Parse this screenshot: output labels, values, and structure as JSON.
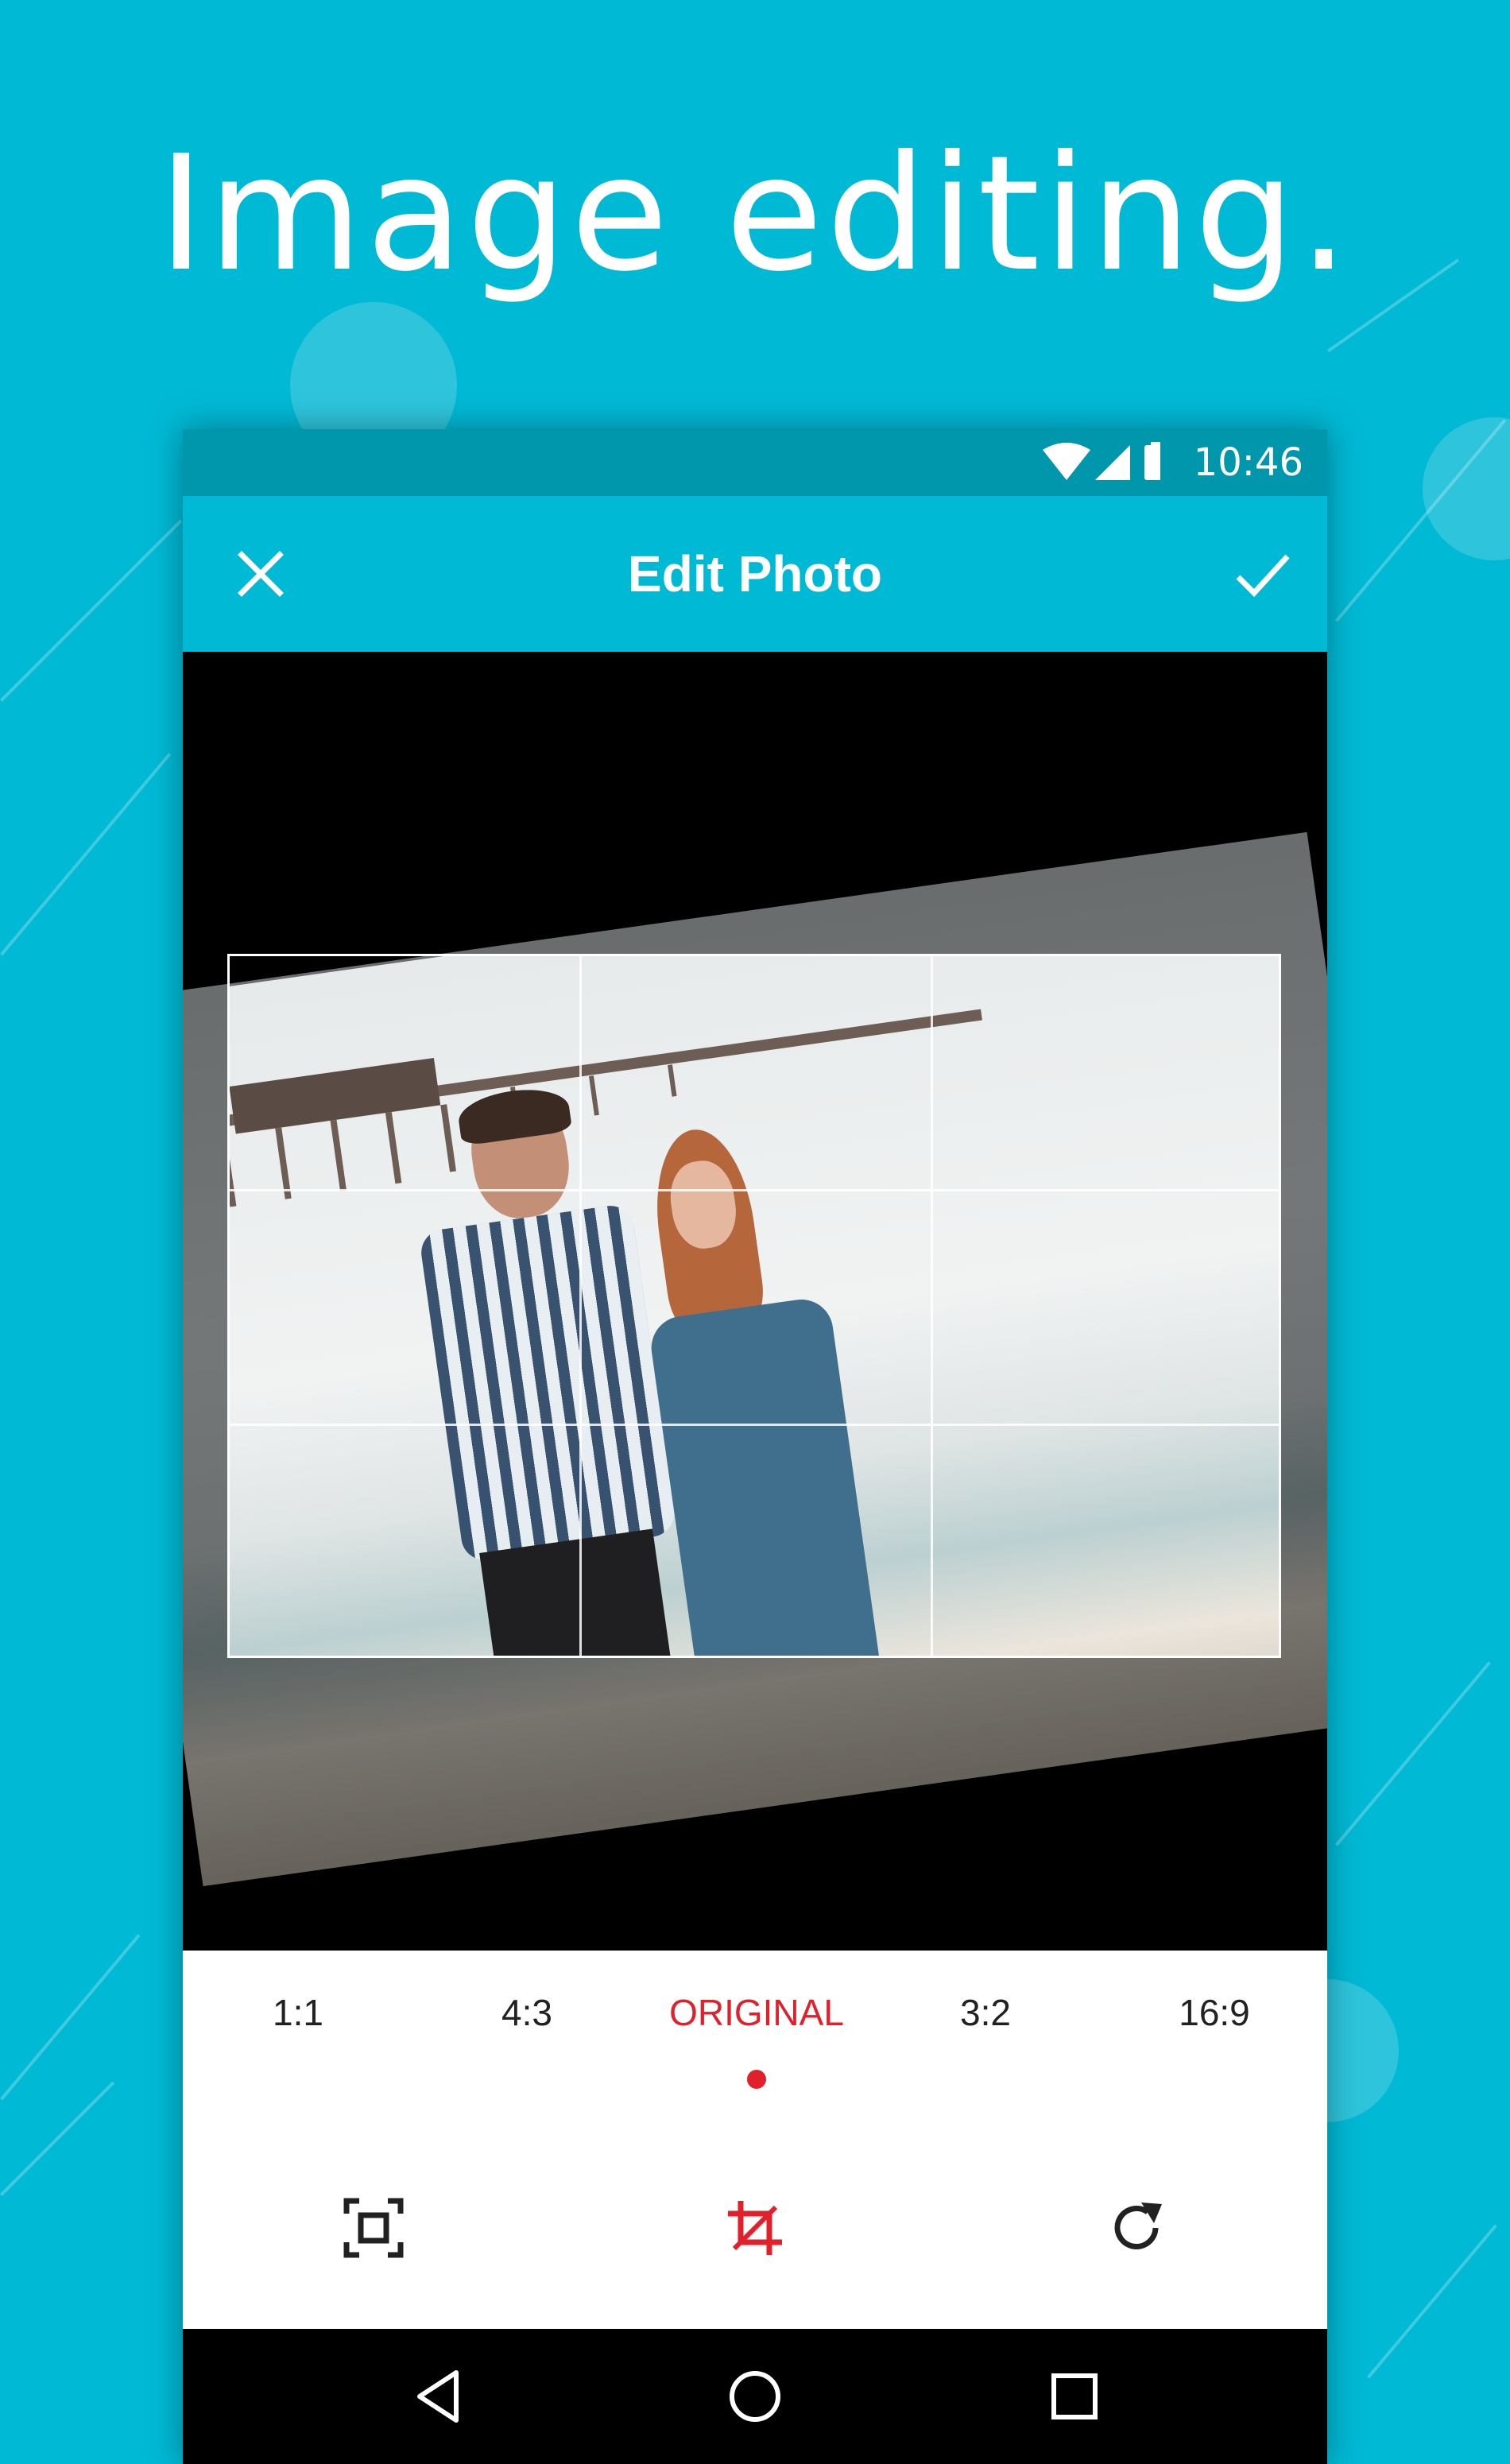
{
  "promo": {
    "headline": "Image editing."
  },
  "status_bar": {
    "time": "10:46"
  },
  "app_bar": {
    "title": "Edit Photo",
    "close_icon": "close-icon",
    "confirm_icon": "check-icon"
  },
  "ratios": {
    "items": [
      "1:1",
      "4:3",
      "ORIGINAL",
      "3:2",
      "16:9"
    ],
    "selected": "ORIGINAL"
  },
  "tools": [
    "fit-screen-icon",
    "crop-icon",
    "rotate-icon"
  ],
  "colors": {
    "brand": "#00b9d5",
    "status_bar": "#0097ad",
    "accent": "#e0212b"
  }
}
